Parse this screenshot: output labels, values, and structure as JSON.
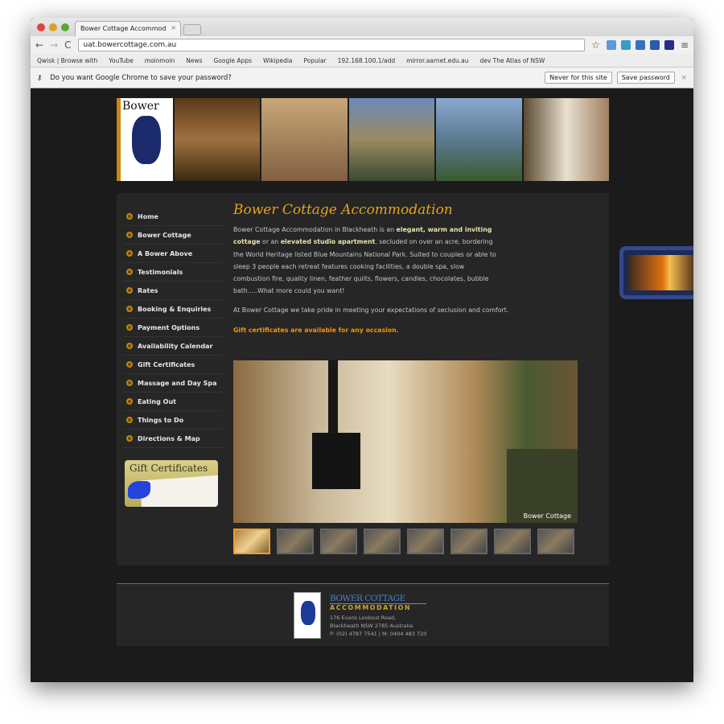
{
  "browser": {
    "tab_title": "Bower Cottage Accommod",
    "url": "uat.bowercottage.com.au",
    "bookmarks": [
      "Qwisk | Browse with",
      "YouTube",
      "moinmoin",
      "News",
      "Google Apps",
      "Wikipedia",
      "Popular",
      "192.168.100.1/add",
      "mirror.aarnet.edu.au",
      "dev The Atlas of NSW"
    ],
    "infobar": {
      "message": "Do you want Google Chrome to save your password?",
      "never": "Never for this site",
      "save": "Save password"
    }
  },
  "banner": {
    "logo_text": "Bower"
  },
  "nav": [
    "Home",
    "Bower Cottage",
    "A Bower Above",
    "Testimonials",
    "Rates",
    "Booking & Enquiries",
    "Payment Options",
    "Availability Calendar",
    "Gift Certificates",
    "Massage and Day Spa",
    "Eating Out",
    "Things to Do",
    "Directions & Map"
  ],
  "gift_box": {
    "title": "Gift Certificates"
  },
  "content": {
    "title": "Bower Cottage Accommodation",
    "p1a": "Bower Cottage Accommodation in Blackheath is an ",
    "p1b": "elegant, warm and inviting cottage",
    "p1c": " or an ",
    "p1d": "elevated studio apartment",
    "p1e": ", secluded on over an acre, bordering the World Heritage listed Blue Mountains National Park. Suited to couples or able to sleep 3 people each retreat features cooking facilities, a double spa, slow combustion fire, quality linen, feather quilts, flowers, candles, chocolates, bubble bath.....What more could you want!",
    "p2": "At Bower Cottage we take pride in meeting your expectations of seclusion and comfort.",
    "gift": "Gift certificates are available for any occasion.",
    "photo_caption": "Bower Cottage",
    "thumb_count": 8,
    "active_thumb": 1
  },
  "footer": {
    "name": "BOWER COTTAGE",
    "sub": "ACCOMMODATION",
    "addr1": "176 Evans Lookout Road,",
    "addr2": "Blackheath  NSW 2785 Australia",
    "phone": "P:  (02) 4787 7541  |  M: 0404 483 720"
  },
  "colors": {
    "accent": "#e6a21c",
    "gift": "#f5920e",
    "page_bg": "#1b1b1b",
    "panel_bg": "#262626"
  }
}
